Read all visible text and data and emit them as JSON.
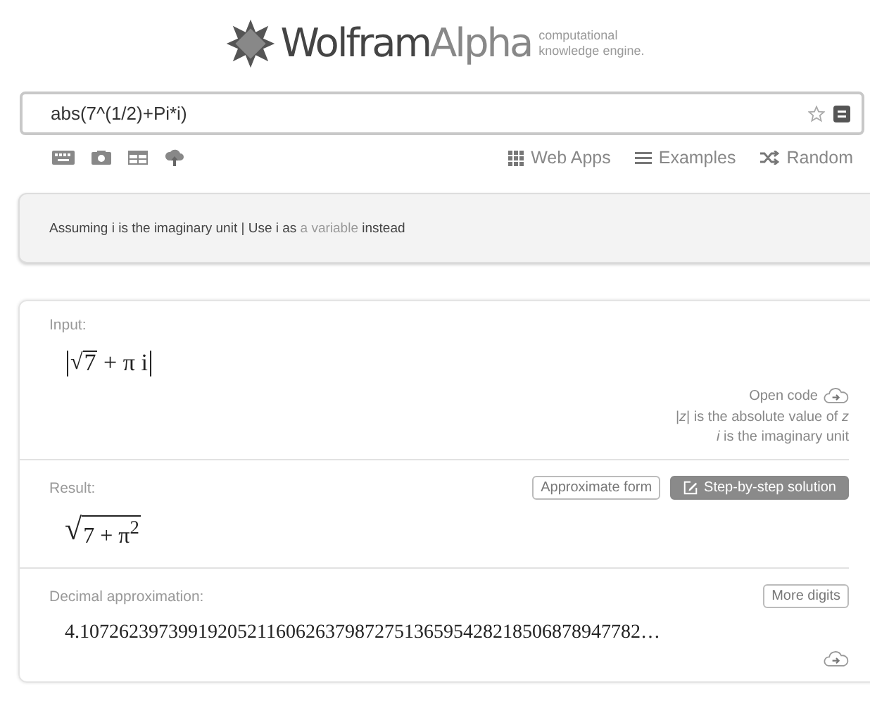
{
  "logo": {
    "name_dark": "Wolfram",
    "name_light": "Alpha",
    "tagline": [
      "computational",
      "knowledge engine."
    ]
  },
  "search": {
    "value": "abs(7^(1/2)+Pi*i)"
  },
  "toolbar": {
    "links": [
      {
        "kind": "apps",
        "label": "Web Apps"
      },
      {
        "kind": "examples",
        "label": "Examples"
      },
      {
        "kind": "random",
        "label": "Random"
      }
    ]
  },
  "assumption": {
    "prefix": "Assuming i is the imaginary unit | Use i as",
    "link": "a variable",
    "suffix": "instead"
  },
  "input_pod": {
    "title": "Input:",
    "math": {
      "bar": "|",
      "radical": "√",
      "radicand": "7",
      "rest": "+ π i",
      "bar_end": "|"
    },
    "open_code": "Open code",
    "notes": [
      "|*z*| is the absolute value of *z*",
      "*i* is the imaginary unit"
    ]
  },
  "result_pod": {
    "title": "Result:",
    "buttons": [
      {
        "kind": "outline",
        "label": "Approximate form"
      },
      {
        "kind": "filled",
        "label": "Step-by-step solution"
      }
    ],
    "radical": "√",
    "math": "7 + π$^{2}$"
  },
  "decimal_pod": {
    "title": "Decimal approximation:",
    "button": "More digits",
    "value": "4.107262397399192052116062637987275136595428218506878947782…"
  }
}
